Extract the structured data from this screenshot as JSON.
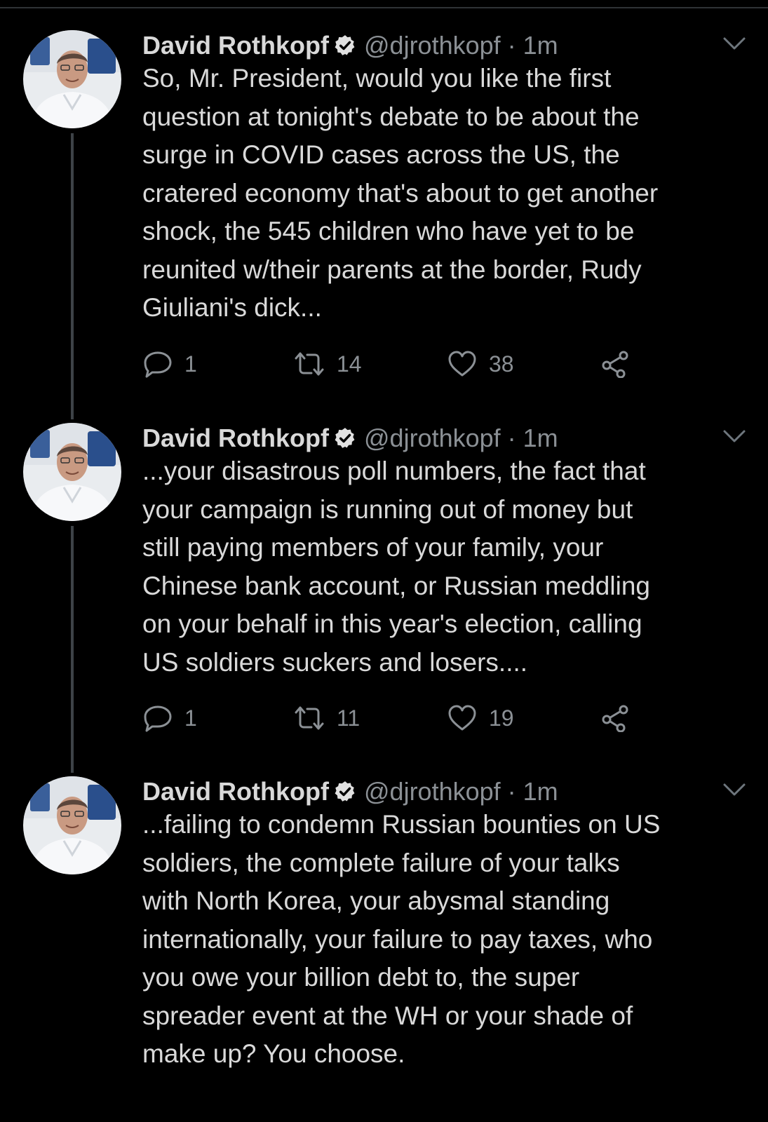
{
  "colors": {
    "background": "#000000",
    "text": "#d9d9d9",
    "muted": "#8b9095",
    "thread_line": "#3d4247"
  },
  "tweets": [
    {
      "author": {
        "name": "David Rothkopf",
        "handle": "@djrothkopf",
        "verified": true,
        "avatar": "avatar-photo"
      },
      "separator": "·",
      "time": "1m",
      "text": "So, Mr. President, would you like the first\nquestion at tonight's debate to be about the\nsurge in COVID cases across the US, the\ncratered economy that's about to get another\nshock, the 545 children who have yet to be\nreunited w/their parents at the border, Rudy\nGiuliani's dick...",
      "stats": {
        "replies": "1",
        "retweets": "14",
        "likes": "38"
      }
    },
    {
      "author": {
        "name": "David Rothkopf",
        "handle": "@djrothkopf",
        "verified": true,
        "avatar": "avatar-photo"
      },
      "separator": "·",
      "time": "1m",
      "text": "...your disastrous poll numbers, the fact that\nyour campaign is running out of money but\nstill paying members of your family, your\nChinese bank account, or Russian meddling\non your behalf in this year's election, calling\nUS soldiers suckers and losers....",
      "stats": {
        "replies": "1",
        "retweets": "11",
        "likes": "19"
      }
    },
    {
      "author": {
        "name": "David Rothkopf",
        "handle": "@djrothkopf",
        "verified": true,
        "avatar": "avatar-photo"
      },
      "separator": "·",
      "time": "1m",
      "text": "...failing to condemn Russian bounties on US\nsoldiers, the complete failure of your talks\nwith North Korea, your abysmal standing\ninternationally, your failure to pay taxes, who\nyou owe your billion debt to, the super\nspreader event at the WH or your shade of\nmake up? You choose."
    }
  ],
  "icons": {
    "reply": "reply-icon",
    "retweet": "retweet-icon",
    "like": "heart-icon",
    "share": "share-icon",
    "menu": "chevron-down-icon",
    "verified": "verified-badge-icon"
  }
}
